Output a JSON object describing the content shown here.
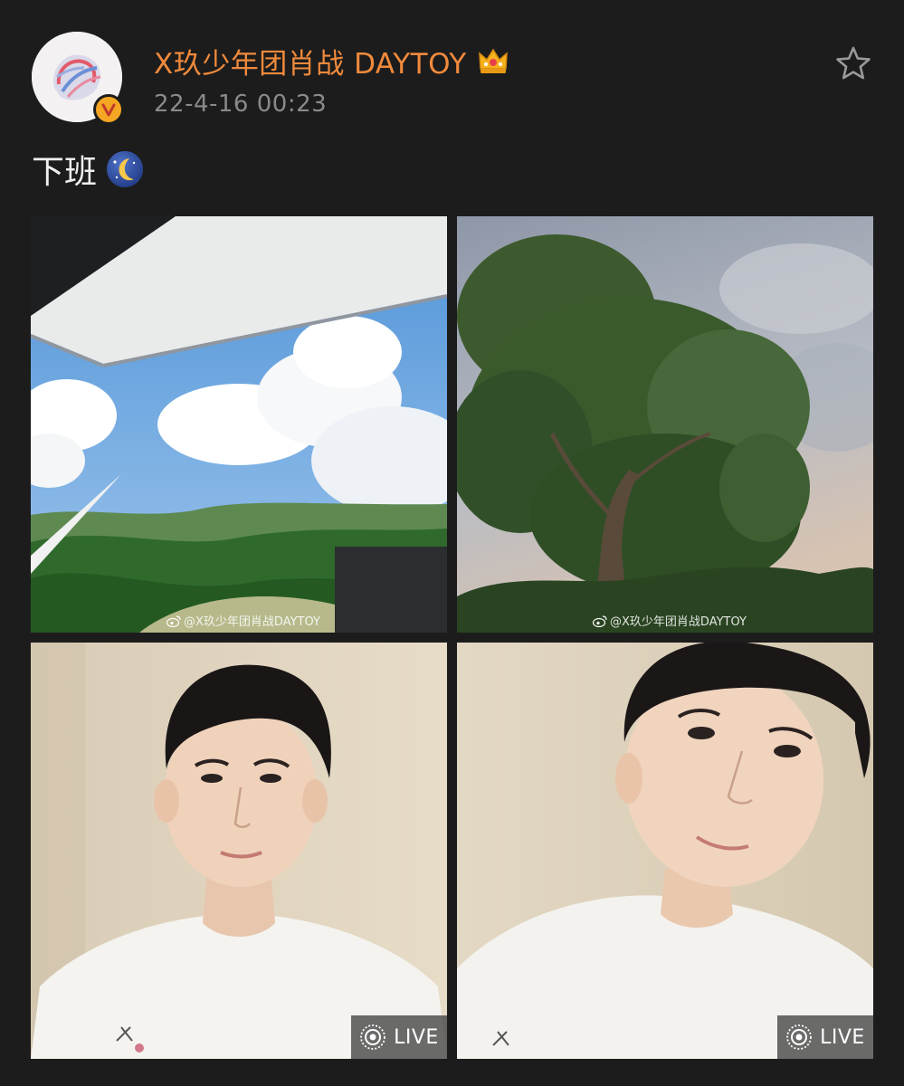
{
  "author": {
    "name": "X玖少年团肖战 DAYTOY",
    "timestamp": "22-4-16 00:23",
    "verified": true,
    "badge_icon": "crown-icon"
  },
  "post": {
    "text": "下班",
    "emoji": "crescent-moon-emoji"
  },
  "photos": [
    {
      "subject": "sky-with-canopy",
      "watermark": "@X玖少年团肖战DAYTOY"
    },
    {
      "subject": "tree-against-sky",
      "watermark": "@X玖少年团肖战DAYTOY"
    },
    {
      "subject": "selfie-front",
      "live_label": "LIVE"
    },
    {
      "subject": "selfie-tilted",
      "live_label": "LIVE"
    }
  ],
  "colors": {
    "background": "#1c1c1c",
    "username": "#f08a3c",
    "timestamp": "#8a8a8a",
    "verified_badge": "#f5a623"
  }
}
